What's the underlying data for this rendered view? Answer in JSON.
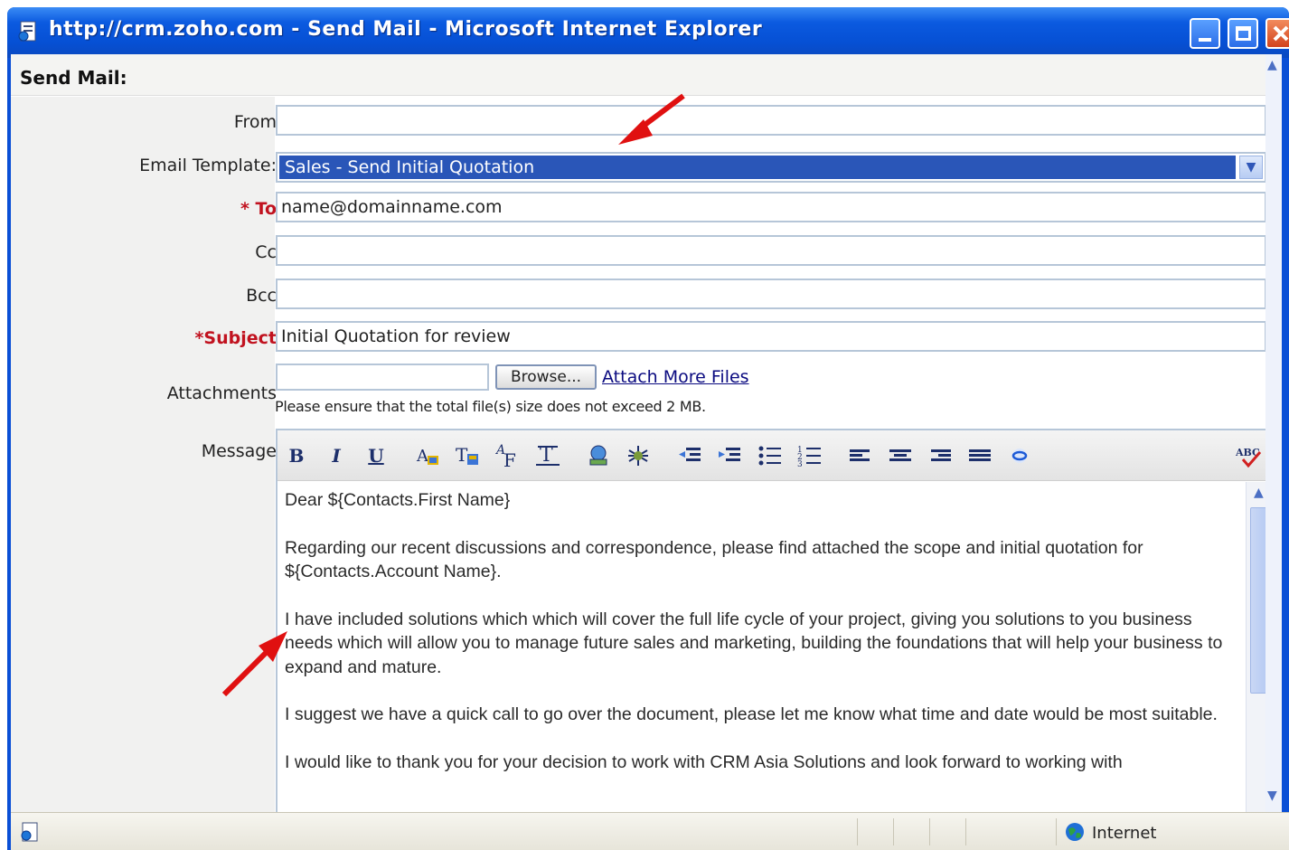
{
  "window": {
    "title": "http://crm.zoho.com - Send Mail - Microsoft Internet Explorer"
  },
  "section": {
    "title": "Send Mail:"
  },
  "form": {
    "from_label": "From",
    "from_value": "",
    "template_label": "Email Template:",
    "template_value": "Sales - Send Initial Quotation",
    "to_required": "* To",
    "to_value": "name@domainname.com",
    "cc_label": "Cc",
    "cc_value": "",
    "bcc_label": "Bcc",
    "bcc_value": "",
    "subject_label": "*Subject",
    "subject_value": "Initial Quotation for review",
    "attachments_label": "Attachments",
    "browse_label": "Browse...",
    "attach_more_label": "Attach More Files",
    "attach_note": "Please ensure that the total file(s) size does not exceed 2 MB.",
    "message_label": "Message"
  },
  "message": {
    "paragraphs": [
      "Dear ${Contacts.First Name}",
      "Regarding our recent discussions and correspondence, please find attached the scope and initial quotation for ${Contacts.Account Name}.",
      "I have included solutions which which will cover the full life cycle of your project, giving you solutions to you business needs which will allow you to manage future sales and marketing, building the foundations that will help your business to expand and mature.",
      "I suggest we have a quick call to go over the document, please let me know what time and date would be most suitable.",
      "I would like to thank you for your decision to work with CRM Asia Solutions and look forward to working with"
    ]
  },
  "toolbar": {
    "bold": "B",
    "italic": "I",
    "underline": "U",
    "font_color": "font-color-icon",
    "highlight": "highlight-icon",
    "font_face": "font-face-icon",
    "font_size": "font-size-icon",
    "insert_image": "insert-image-icon",
    "insert_table": "insert-table-icon",
    "outdent": "outdent-icon",
    "indent": "indent-icon",
    "bullets": "bulleted-list-icon",
    "numbering": "numbered-list-icon",
    "align_left": "align-left-icon",
    "align_center": "align-center-icon",
    "align_right": "align-right-icon",
    "justify": "justify-icon",
    "link": "link-icon",
    "spell": "spell-check-icon"
  },
  "statusbar": {
    "zone": "Internet"
  },
  "colors": {
    "accent": "#2a56b8",
    "required": "#c1121f",
    "arrow": "#e01010"
  }
}
